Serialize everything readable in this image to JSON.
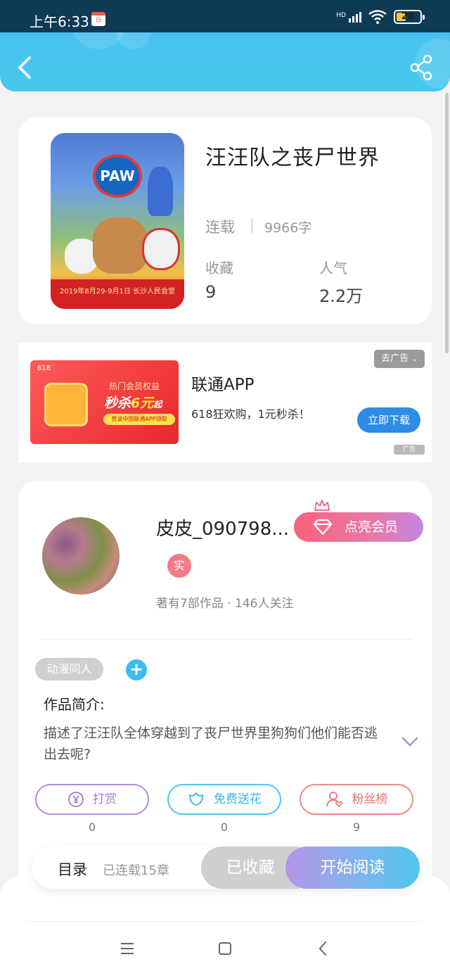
{
  "status_bar": {
    "time": "上午6:33",
    "calendar_day": "日历",
    "network": "HD",
    "battery": "28"
  },
  "header": {
    "back_icon": "chevron-left-icon",
    "share_icon": "share-icon"
  },
  "book": {
    "title": "汪汪队之丧尸世界",
    "status": "连载",
    "word_count": "9966字",
    "stats": [
      {
        "label": "收藏",
        "value": "9"
      },
      {
        "label": "人气",
        "value": "2.2万"
      }
    ],
    "cover_text": {
      "logo": "PAW",
      "date_line": "2019年8月29-9月1日 长沙人民会堂"
    }
  },
  "ad": {
    "image_text": {
      "tag": "618",
      "line1": "热门会员权益",
      "line2_prefix": "秒杀",
      "line2_highlight": "6元",
      "line2_suffix": "起",
      "line3": "登录中国联通APP领取"
    },
    "title": "联通APP",
    "description": "618狂欢购，1元秒杀！",
    "remove_label": "去广告",
    "download_label": "立即下载",
    "ad_mark": "广告"
  },
  "author": {
    "name": "皮皮_090798...",
    "vip_label": "点亮会员",
    "real_badge": "实",
    "meta": "著有7部作品 · 146人关注",
    "tag": "动漫同人",
    "intro_title": "作品简介:",
    "intro_text": "描述了汪汪队全体穿越到了丧尸世界里狗狗们他们能否逃出去呢?",
    "actions": [
      {
        "label": "打赏",
        "count": "0"
      },
      {
        "label": "免费送花",
        "count": "0"
      },
      {
        "label": "粉丝榜",
        "count": "9"
      }
    ]
  },
  "bottom_bar": {
    "toc_label": "目录",
    "toc_count": "已连载15章",
    "fav_label": "已收藏",
    "read_label": "开始阅读"
  },
  "colors": {
    "header": "#46c8ee",
    "accent_blue": "#2e8be6",
    "vip_pink": "#f7627a",
    "read_gradient_end": "#4fc7ee"
  }
}
